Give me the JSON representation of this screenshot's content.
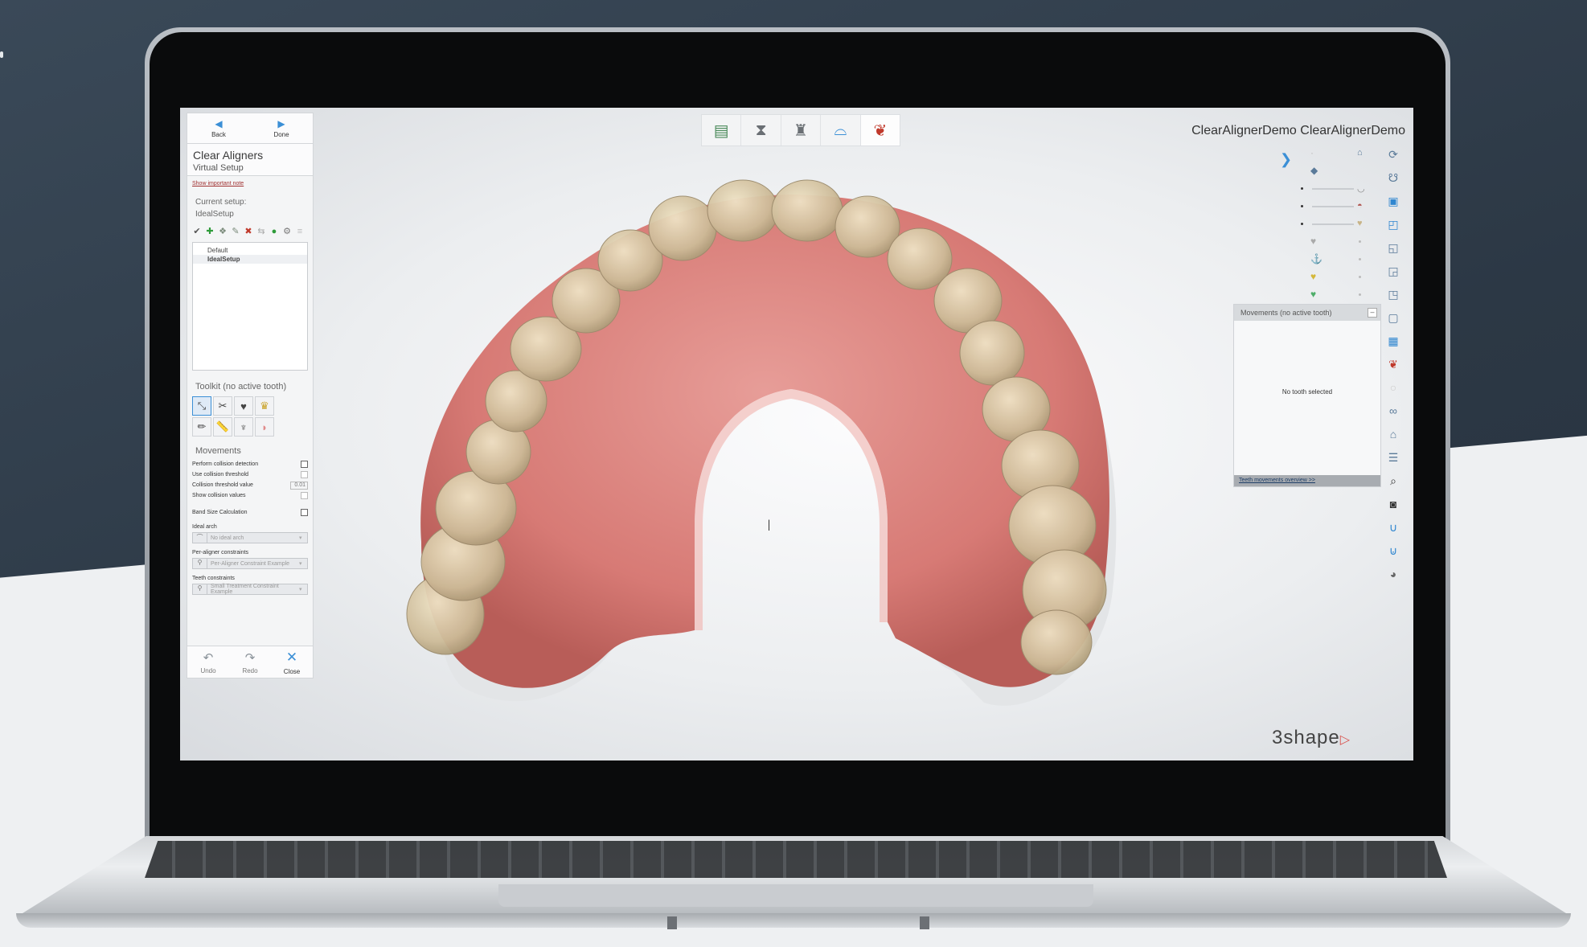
{
  "left_panel": {
    "nav": {
      "back": "Back",
      "done": "Done"
    },
    "title": "Clear Aligners",
    "subtitle": "Virtual Setup",
    "note_link": "Show important note",
    "current_setup_label": "Current setup:",
    "current_setup_value": "IdealSetup",
    "setups": [
      "Default",
      "IdealSetup"
    ],
    "toolkit_title": "Toolkit (no active tooth)",
    "movements_title": "Movements",
    "options": {
      "collision_detection": "Perform collision detection",
      "collision_threshold": "Use collision threshold",
      "collision_threshold_value": "Collision threshold value",
      "threshold_value": "0.01",
      "show_collision_values": "Show collision values",
      "band_size": "Band Size Calculation"
    },
    "ideal_arch_label": "Ideal arch",
    "ideal_arch_value": "No ideal arch",
    "per_aligner_label": "Per-aligner constraints",
    "per_aligner_value": "Per-Aligner Constraint Example",
    "teeth_constraints_label": "Teeth constraints",
    "teeth_constraints_value": "Small Treatment Constraint Example",
    "bottom": {
      "undo": "Undo",
      "redo": "Redo",
      "close": "Close"
    }
  },
  "case_title": "ClearAlignerDemo ClearAlignerDemo",
  "movements_panel": {
    "title": "Movements (no active tooth)",
    "empty": "No tooth selected",
    "link": "Teeth movements overview >>"
  },
  "logo": "3shape",
  "colors": {
    "accent": "#3b8fd6",
    "gum": "#d97f7a",
    "tooth": "#d8c9a6"
  }
}
